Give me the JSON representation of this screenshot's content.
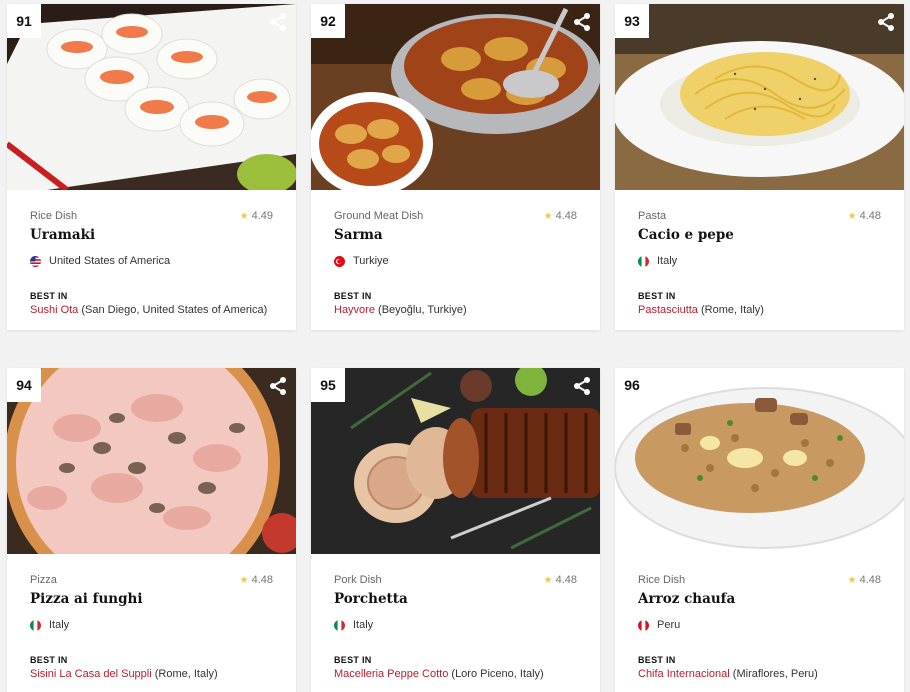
{
  "cards": [
    {
      "rank": "91",
      "category": "Rice Dish",
      "rating": "4.49",
      "name": "Uramaki",
      "country": "United States of America",
      "best_in_label": "BEST IN",
      "restaurant": "Sushi Ota",
      "location": "(San Diego, United States of America)",
      "flag_icon": "us-flag-icon"
    },
    {
      "rank": "92",
      "category": "Ground Meat Dish",
      "rating": "4.48",
      "name": "Sarma",
      "country": "Turkiye",
      "best_in_label": "BEST IN",
      "restaurant": "Hayvore",
      "location": "(Beyoğlu, Turkiye)",
      "flag_icon": "turkiye-flag-icon"
    },
    {
      "rank": "93",
      "category": "Pasta",
      "rating": "4.48",
      "name": "Cacio e pepe",
      "country": "Italy",
      "best_in_label": "BEST IN",
      "restaurant": "Pastasciutta",
      "location": "(Rome, Italy)",
      "flag_icon": "italy-flag-icon"
    },
    {
      "rank": "94",
      "category": "Pizza",
      "rating": "4.48",
      "name": "Pizza ai funghi",
      "country": "Italy",
      "best_in_label": "BEST IN",
      "restaurant": "Sisini La Casa del Suppli",
      "location": "(Rome, Italy)",
      "flag_icon": "italy-flag-icon"
    },
    {
      "rank": "95",
      "category": "Pork Dish",
      "rating": "4.48",
      "name": "Porchetta",
      "country": "Italy",
      "best_in_label": "BEST IN",
      "restaurant": "Macelleria Peppe Cotto",
      "location": "(Loro Piceno, Italy)",
      "flag_icon": "italy-flag-icon"
    },
    {
      "rank": "96",
      "category": "Rice Dish",
      "rating": "4.48",
      "name": "Arroz chaufa",
      "country": "Peru",
      "best_in_label": "BEST IN",
      "restaurant": "Chifa Internacional",
      "location": "(Miraflores, Peru)",
      "flag_icon": "peru-flag-icon"
    }
  ],
  "icons": {
    "share": "share-icon",
    "star": "star-icon"
  },
  "colors": {
    "accent": "#b8202c",
    "star": "#f0c94a"
  }
}
